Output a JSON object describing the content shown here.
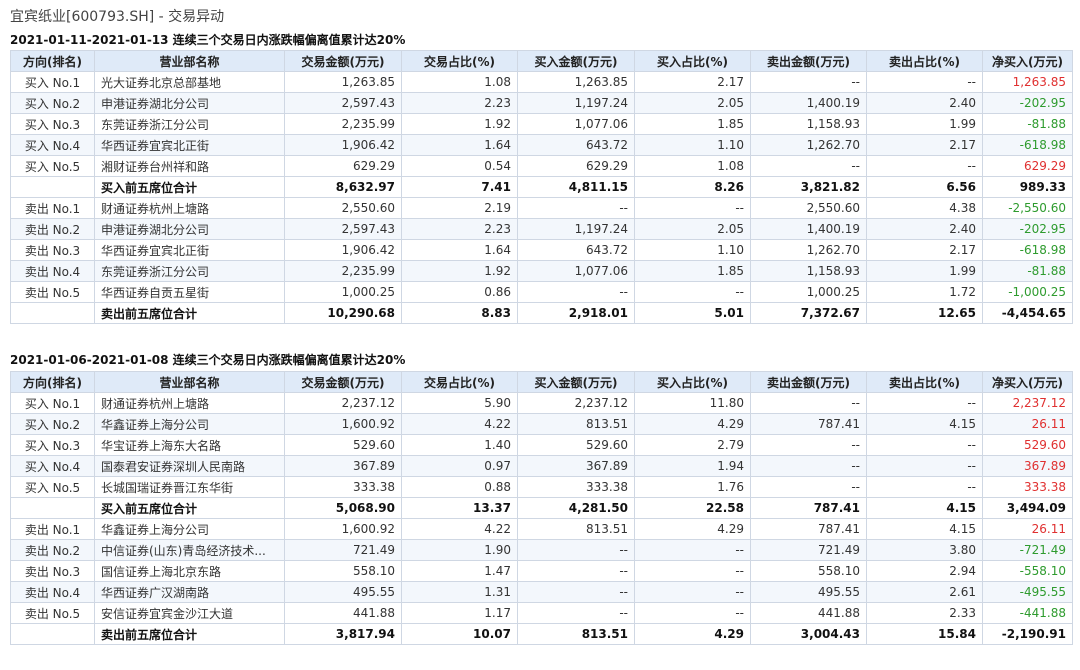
{
  "page_title": "宜宾纸业[600793.SH] - 交易异动",
  "headers": [
    "方向(排名)",
    "营业部名称",
    "交易金额(万元)",
    "交易占比(%)",
    "买入金额(万元)",
    "买入占比(%)",
    "卖出金额(万元)",
    "卖出占比(%)",
    "净买入(万元)"
  ],
  "sections": [
    {
      "title": "2021-01-11-2021-01-13 连续三个交易日内涨跌幅偏离值累计达20%",
      "rows": [
        {
          "dir": "买入 No.1",
          "name": "光大证券北京总部基地",
          "amt": "1,263.85",
          "amt_pct": "1.08",
          "buy": "1,263.85",
          "buy_pct": "2.17",
          "sell": "--",
          "sell_pct": "--",
          "net": "1,263.85",
          "sign": "pos"
        },
        {
          "dir": "买入 No.2",
          "name": "申港证券湖北分公司",
          "amt": "2,597.43",
          "amt_pct": "2.23",
          "buy": "1,197.24",
          "buy_pct": "2.05",
          "sell": "1,400.19",
          "sell_pct": "2.40",
          "net": "-202.95",
          "sign": "neg"
        },
        {
          "dir": "买入 No.3",
          "name": "东莞证券浙江分公司",
          "amt": "2,235.99",
          "amt_pct": "1.92",
          "buy": "1,077.06",
          "buy_pct": "1.85",
          "sell": "1,158.93",
          "sell_pct": "1.99",
          "net": "-81.88",
          "sign": "neg"
        },
        {
          "dir": "买入 No.4",
          "name": "华西证券宜宾北正街",
          "amt": "1,906.42",
          "amt_pct": "1.64",
          "buy": "643.72",
          "buy_pct": "1.10",
          "sell": "1,262.70",
          "sell_pct": "2.17",
          "net": "-618.98",
          "sign": "neg"
        },
        {
          "dir": "买入 No.5",
          "name": "湘财证券台州祥和路",
          "amt": "629.29",
          "amt_pct": "0.54",
          "buy": "629.29",
          "buy_pct": "1.08",
          "sell": "--",
          "sell_pct": "--",
          "net": "629.29",
          "sign": "pos"
        },
        {
          "dir": "",
          "name": "买入前五席位合计",
          "amt": "8,632.97",
          "amt_pct": "7.41",
          "buy": "4,811.15",
          "buy_pct": "8.26",
          "sell": "3,821.82",
          "sell_pct": "6.56",
          "net": "989.33",
          "sign": "pos",
          "sum": true
        },
        {
          "dir": "卖出 No.1",
          "name": "财通证券杭州上塘路",
          "amt": "2,550.60",
          "amt_pct": "2.19",
          "buy": "--",
          "buy_pct": "--",
          "sell": "2,550.60",
          "sell_pct": "4.38",
          "net": "-2,550.60",
          "sign": "neg"
        },
        {
          "dir": "卖出 No.2",
          "name": "申港证券湖北分公司",
          "amt": "2,597.43",
          "amt_pct": "2.23",
          "buy": "1,197.24",
          "buy_pct": "2.05",
          "sell": "1,400.19",
          "sell_pct": "2.40",
          "net": "-202.95",
          "sign": "neg"
        },
        {
          "dir": "卖出 No.3",
          "name": "华西证券宜宾北正街",
          "amt": "1,906.42",
          "amt_pct": "1.64",
          "buy": "643.72",
          "buy_pct": "1.10",
          "sell": "1,262.70",
          "sell_pct": "2.17",
          "net": "-618.98",
          "sign": "neg"
        },
        {
          "dir": "卖出 No.4",
          "name": "东莞证券浙江分公司",
          "amt": "2,235.99",
          "amt_pct": "1.92",
          "buy": "1,077.06",
          "buy_pct": "1.85",
          "sell": "1,158.93",
          "sell_pct": "1.99",
          "net": "-81.88",
          "sign": "neg"
        },
        {
          "dir": "卖出 No.5",
          "name": "华西证券自贡五星街",
          "amt": "1,000.25",
          "amt_pct": "0.86",
          "buy": "--",
          "buy_pct": "--",
          "sell": "1,000.25",
          "sell_pct": "1.72",
          "net": "-1,000.25",
          "sign": "neg"
        },
        {
          "dir": "",
          "name": "卖出前五席位合计",
          "amt": "10,290.68",
          "amt_pct": "8.83",
          "buy": "2,918.01",
          "buy_pct": "5.01",
          "sell": "7,372.67",
          "sell_pct": "12.65",
          "net": "-4,454.65",
          "sign": "neg",
          "sum": true
        }
      ]
    },
    {
      "title": "2021-01-06-2021-01-08 连续三个交易日内涨跌幅偏离值累计达20%",
      "rows": [
        {
          "dir": "买入 No.1",
          "name": "财通证券杭州上塘路",
          "amt": "2,237.12",
          "amt_pct": "5.90",
          "buy": "2,237.12",
          "buy_pct": "11.80",
          "sell": "--",
          "sell_pct": "--",
          "net": "2,237.12",
          "sign": "pos"
        },
        {
          "dir": "买入 No.2",
          "name": "华鑫证券上海分公司",
          "amt": "1,600.92",
          "amt_pct": "4.22",
          "buy": "813.51",
          "buy_pct": "4.29",
          "sell": "787.41",
          "sell_pct": "4.15",
          "net": "26.11",
          "sign": "pos"
        },
        {
          "dir": "买入 No.3",
          "name": "华宝证券上海东大名路",
          "amt": "529.60",
          "amt_pct": "1.40",
          "buy": "529.60",
          "buy_pct": "2.79",
          "sell": "--",
          "sell_pct": "--",
          "net": "529.60",
          "sign": "pos"
        },
        {
          "dir": "买入 No.4",
          "name": "国泰君安证券深圳人民南路",
          "amt": "367.89",
          "amt_pct": "0.97",
          "buy": "367.89",
          "buy_pct": "1.94",
          "sell": "--",
          "sell_pct": "--",
          "net": "367.89",
          "sign": "pos"
        },
        {
          "dir": "买入 No.5",
          "name": "长城国瑞证券晋江东华街",
          "amt": "333.38",
          "amt_pct": "0.88",
          "buy": "333.38",
          "buy_pct": "1.76",
          "sell": "--",
          "sell_pct": "--",
          "net": "333.38",
          "sign": "pos"
        },
        {
          "dir": "",
          "name": "买入前五席位合计",
          "amt": "5,068.90",
          "amt_pct": "13.37",
          "buy": "4,281.50",
          "buy_pct": "22.58",
          "sell": "787.41",
          "sell_pct": "4.15",
          "net": "3,494.09",
          "sign": "pos",
          "sum": true
        },
        {
          "dir": "卖出 No.1",
          "name": "华鑫证券上海分公司",
          "amt": "1,600.92",
          "amt_pct": "4.22",
          "buy": "813.51",
          "buy_pct": "4.29",
          "sell": "787.41",
          "sell_pct": "4.15",
          "net": "26.11",
          "sign": "pos"
        },
        {
          "dir": "卖出 No.2",
          "name": "中信证券(山东)青岛经济技术...",
          "amt": "721.49",
          "amt_pct": "1.90",
          "buy": "--",
          "buy_pct": "--",
          "sell": "721.49",
          "sell_pct": "3.80",
          "net": "-721.49",
          "sign": "neg"
        },
        {
          "dir": "卖出 No.3",
          "name": "国信证券上海北京东路",
          "amt": "558.10",
          "amt_pct": "1.47",
          "buy": "--",
          "buy_pct": "--",
          "sell": "558.10",
          "sell_pct": "2.94",
          "net": "-558.10",
          "sign": "neg"
        },
        {
          "dir": "卖出 No.4",
          "name": "华西证券广汉湖南路",
          "amt": "495.55",
          "amt_pct": "1.31",
          "buy": "--",
          "buy_pct": "--",
          "sell": "495.55",
          "sell_pct": "2.61",
          "net": "-495.55",
          "sign": "neg"
        },
        {
          "dir": "卖出 No.5",
          "name": "安信证券宜宾金沙江大道",
          "amt": "441.88",
          "amt_pct": "1.17",
          "buy": "--",
          "buy_pct": "--",
          "sell": "441.88",
          "sell_pct": "2.33",
          "net": "-441.88",
          "sign": "neg"
        },
        {
          "dir": "",
          "name": "卖出前五席位合计",
          "amt": "3,817.94",
          "amt_pct": "10.07",
          "buy": "813.51",
          "buy_pct": "4.29",
          "sell": "3,004.43",
          "sell_pct": "15.84",
          "net": "-2,190.91",
          "sign": "neg",
          "sum": true
        }
      ]
    }
  ]
}
